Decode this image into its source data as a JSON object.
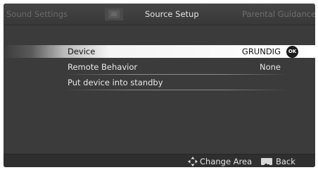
{
  "tabs": {
    "left": "Sound Settings",
    "center": "Source Setup",
    "right": "Parental Guidance"
  },
  "menu": {
    "items": [
      {
        "label": "Device",
        "value": "GRUNDIG",
        "selected": true
      },
      {
        "label": "Remote Behavior",
        "value": "None",
        "selected": false
      },
      {
        "label": "Put device into standby",
        "value": "",
        "selected": false
      }
    ],
    "ok_badge": "OK"
  },
  "footer": {
    "change_area_label": "Change Area",
    "back_label": "Back"
  },
  "icons": {
    "tab": "source-setup-icon",
    "navigation": "dpad-arrows-icon",
    "back": "back-arrow-icon"
  },
  "colors": {
    "background": "#3b3b3b",
    "highlight": "#ffffff",
    "text": "#e8e8e8"
  }
}
